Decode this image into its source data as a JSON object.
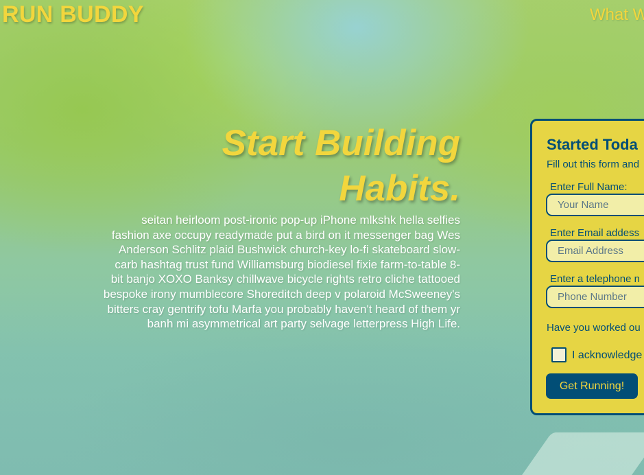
{
  "header": {
    "logo": "RUN BUDDY",
    "nav": [
      {
        "label": "What W"
      }
    ]
  },
  "hero": {
    "title_line1": "Start Building",
    "title_line2": "Habits.",
    "body": "seitan heirloom post-ironic pop-up iPhone mlkshk hella selfies fashion axe occupy readymade put a bird on it messenger bag Wes Anderson Schlitz plaid Bushwick church-key lo-fi skateboard slow-carb hashtag trust fund Williamsburg biodiesel fixie farm-to-table 8-bit banjo XOXO Banksy chillwave bicycle rights retro cliche tattooed bespoke irony mumblecore Shoreditch deep v polaroid McSweeney's bitters cray gentrify tofu Marfa you probably haven't heard of them yr banh mi asymmetrical art party selvage letterpress High Life."
  },
  "form": {
    "title": "Started Toda",
    "subtitle": "Fill out this form and",
    "fields": [
      {
        "label": "Enter Full Name:",
        "placeholder": "Your Name"
      },
      {
        "label": "Enter Email addess",
        "placeholder": "Email Address"
      },
      {
        "label": "Enter a telephone n",
        "placeholder": "Phone Number"
      }
    ],
    "question": "Have you worked ou",
    "checkbox_label": "I acknowledge",
    "submit_label": "Get Running!"
  },
  "colors": {
    "accent_yellow": "#f2d63d",
    "brand_navy": "#024e76",
    "form_background": "#e6d544"
  }
}
